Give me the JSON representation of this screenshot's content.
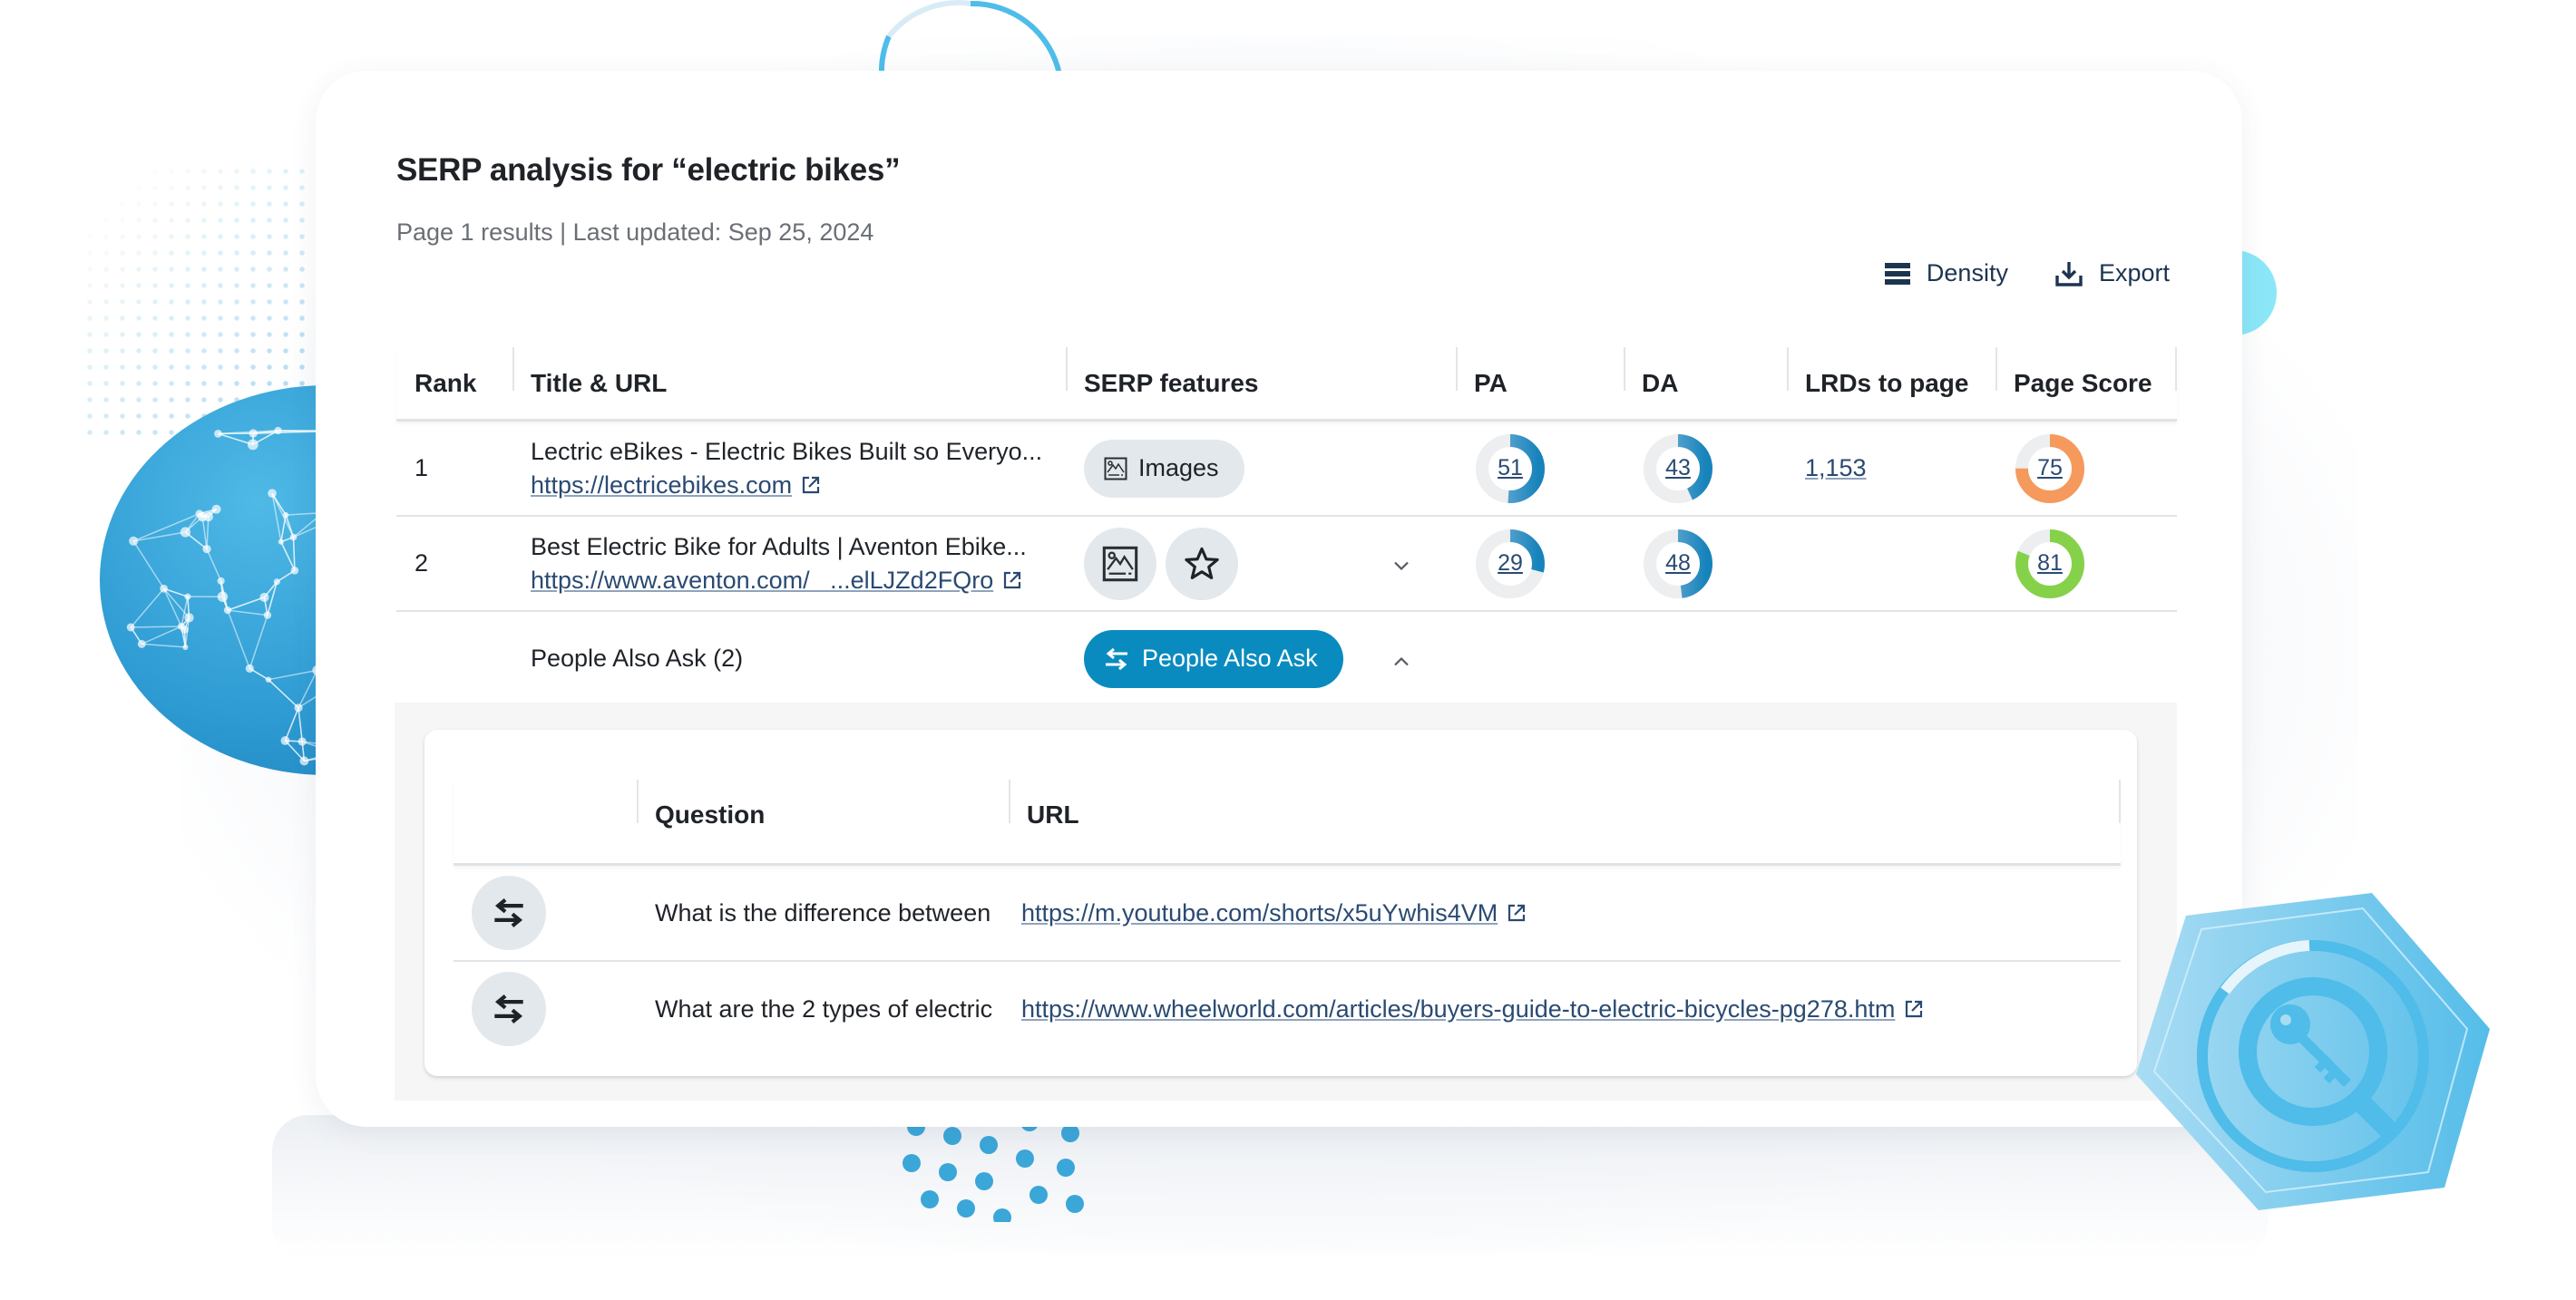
{
  "header": {
    "title": "SERP analysis for “electric bikes”",
    "subtitle": "Page 1 results | Last updated: Sep 25, 2024"
  },
  "toolbar": {
    "density_label": "Density",
    "density_icon": "density-icon",
    "export_label": "Export",
    "export_icon": "download-icon"
  },
  "table": {
    "columns": [
      "Rank",
      "Title & URL",
      "SERP features",
      "PA",
      "DA",
      "LRDs to page",
      "Page Score"
    ],
    "rows": [
      {
        "rank": "1",
        "title": "Lectric eBikes - Electric Bikes Built so Everyo...",
        "url": "https://lectricebikes.com",
        "serp_features": [
          {
            "icon": "image-icon",
            "label": "Images"
          }
        ],
        "pa": 51,
        "da": 43,
        "lrds": "1,153",
        "page_score": 75,
        "page_score_color": "#f59a5c"
      },
      {
        "rank": "2",
        "title": "Best Electric Bike for Adults | Aventon Ebike...",
        "url": "https://www.aventon.com/   ...elLJZd2FQro",
        "serp_features": [
          {
            "icon": "image-icon",
            "label": ""
          },
          {
            "icon": "star-icon",
            "label": ""
          }
        ],
        "expand_icon": "chevron-down-icon",
        "pa": 29,
        "da": 48,
        "lrds": "",
        "page_score": 81,
        "page_score_color": "#86d14a"
      }
    ],
    "paa_row": {
      "label": "People Also Ask (2)",
      "button_label": "People Also Ask",
      "button_icon": "swap-arrows-icon",
      "collapse_icon": "chevron-up-icon"
    }
  },
  "paa": {
    "columns": [
      "",
      "Question",
      "URL"
    ],
    "rows": [
      {
        "icon": "swap-arrows-icon",
        "question": "What is the difference between",
        "url": "https://m.youtube.com/shorts/x5uYwhis4VM"
      },
      {
        "icon": "swap-arrows-icon",
        "question": "What are the 2 types of electric",
        "url": "https://www.wheelworld.com/articles/buyers-guide-to-electric-bicycles-pg278.htm"
      }
    ]
  },
  "colors": {
    "accent": "#0a8bbf",
    "link": "#2a4a72",
    "metric_blue": "#2f8fc6",
    "chip_bg": "#e3e8ed",
    "track": "#eceeef"
  }
}
